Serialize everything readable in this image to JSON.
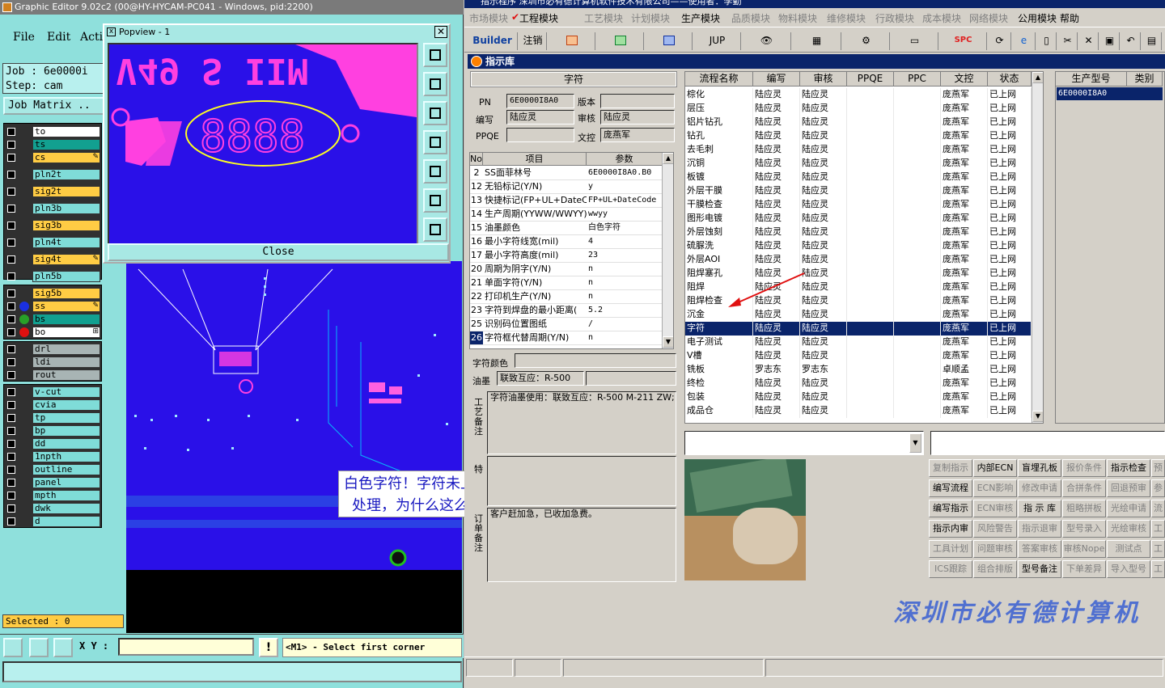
{
  "ge": {
    "title": "Graphic Editor 9.02c2 (00@HY-HYCAM-PC041 - Windows, pid:2200)",
    "menu": [
      "File",
      "Edit",
      "Acti"
    ],
    "job_line": "Job  :  6e0000i",
    "step_line": "Step:  cam",
    "job_matrix": "Job Matrix ..",
    "layers": [
      {
        "name": "to",
        "color": "#ffffff"
      },
      {
        "name": "ts",
        "color": "#12a090"
      },
      {
        "name": "cs",
        "color": "#ffcc44",
        "mark": "✎"
      },
      {
        "name": "pln2t",
        "color": "#7fdcd8"
      },
      {
        "name": "sig2t",
        "color": "#ffcc44"
      },
      {
        "name": "pln3b",
        "color": "#7fdcd8"
      },
      {
        "name": "sig3b",
        "color": "#ffcc44"
      },
      {
        "name": "pln4t",
        "color": "#7fdcd8"
      },
      {
        "name": "sig4t",
        "color": "#ffcc44",
        "mark": "✎"
      },
      {
        "name": "pln5b",
        "color": "#7fdcd8"
      },
      {
        "name": "sig5b",
        "color": "#ffcc44"
      },
      {
        "name": "ss",
        "color": "#ffcc44",
        "dot": "#1a30e0",
        "mark": "✎"
      },
      {
        "name": "bs",
        "color": "#12a090",
        "dot": "#28a028"
      },
      {
        "name": "bo",
        "color": "#ffffff",
        "dot": "#e01010",
        "mark": "⊞"
      },
      {
        "name": "drl",
        "color": "#a8b4b4"
      },
      {
        "name": "ldi",
        "color": "#a8b4b4"
      },
      {
        "name": "rout",
        "color": "#a8b4b4"
      },
      {
        "name": "v-cut",
        "color": "#7fdcd8"
      },
      {
        "name": "cvia",
        "color": "#7fdcd8"
      },
      {
        "name": "tp",
        "color": "#7fdcd8"
      },
      {
        "name": "bp",
        "color": "#7fdcd8"
      },
      {
        "name": "dd",
        "color": "#7fdcd8"
      },
      {
        "name": "1npth",
        "color": "#7fdcd8"
      },
      {
        "name": "outline",
        "color": "#7fdcd8"
      },
      {
        "name": "panel",
        "color": "#7fdcd8"
      },
      {
        "name": "mpth",
        "color": "#7fdcd8"
      },
      {
        "name": "dwk",
        "color": "#7fdcd8"
      },
      {
        "name": "d",
        "color": "#7fdcd8"
      }
    ],
    "selected": "Selected : 0",
    "xy_label": "X Y :",
    "xy_value": "",
    "bang": "!",
    "prompt": "<M1> - Select first corner",
    "popview": {
      "title": "Popview - 1",
      "close": "Close",
      "silk_top": "V49 S IIM",
      "digits": "8888"
    },
    "annotation": [
      "白色字符！字符未上表面",
      "处理，为什么这么做？"
    ]
  },
  "erp": {
    "title": "指示程序    深圳市必有德计算机软件技术有限公司——使用者：李勤",
    "menu": [
      {
        "label": "市场模块",
        "on": false
      },
      {
        "label": "工程模块",
        "on": true
      },
      {
        "label": "工艺模块",
        "on": false
      },
      {
        "label": "计划模块",
        "on": false
      },
      {
        "label": "生产模块",
        "on": true
      },
      {
        "label": "品质模块",
        "on": false
      },
      {
        "label": "物料模块",
        "on": false
      },
      {
        "label": "维修模块",
        "on": false
      },
      {
        "label": "行政模块",
        "on": false
      },
      {
        "label": "成本模块",
        "on": false
      },
      {
        "label": "网络模块",
        "on": false
      },
      {
        "label": "公用模块",
        "on": true
      },
      {
        "label": "帮助",
        "on": true
      }
    ],
    "toolbar": [
      "Builder",
      "注销",
      "JUP",
      "SPC"
    ],
    "panel_title": "指示库",
    "header_group": "字符",
    "pn_label": "PN",
    "pn_value": "6E0000I8A0",
    "ver_label": "版本",
    "ver_value": "",
    "bianxie_label": "编写",
    "bianxie_value": "陆应灵",
    "shenhe_label": "审核",
    "shenhe_value": "陆应灵",
    "ppqe_label": "PPQE",
    "ppqe_value": "",
    "wenkong_label": "文控",
    "wenkong_value": "庞燕军",
    "param_headers": [
      "No",
      "项目",
      "参数"
    ],
    "params": [
      {
        "no": "2",
        "item": "SS面菲林号",
        "val": "6E0000I8A0.B0"
      },
      {
        "no": "12",
        "item": "无铅标记(Y/N)",
        "val": "y"
      },
      {
        "no": "13",
        "item": "快捷标记(FP+UL+DateCo",
        "val": "FP+UL+DateCode"
      },
      {
        "no": "14",
        "item": "生产周期(YYWW/WWYY)",
        "val": "wwyy"
      },
      {
        "no": "15",
        "item": "油墨颜色",
        "val": "白色字符"
      },
      {
        "no": "16",
        "item": "最小字符线宽(mil)",
        "val": "4"
      },
      {
        "no": "17",
        "item": "最小字符高度(mil)",
        "val": "23"
      },
      {
        "no": "20",
        "item": "周期为阴字(Y/N)",
        "val": "n"
      },
      {
        "no": "21",
        "item": "单面字符(Y/N)",
        "val": "n"
      },
      {
        "no": "22",
        "item": "打印机生产(Y/N)",
        "val": "n"
      },
      {
        "no": "23",
        "item": "字符到焊盘的最小距离(",
        "val": "5.2"
      },
      {
        "no": "25",
        "item": "识别码位置图纸",
        "val": "/"
      },
      {
        "no": "26",
        "item": "字符框代替周期(Y/N)",
        "val": "n"
      }
    ],
    "char_color_label": "字符颜色",
    "char_color_value": "",
    "ink_label": "油墨",
    "ink_value": "联致互应：R-500",
    "ink_value2": "",
    "gyb_label": "工艺备注",
    "gyb_text": "字符油墨使用：联致互应：R-500 M-211 ZW;",
    "te_label": "特",
    "dd_label": "订单备注",
    "dd_text": "客户赶加急，已收加急费。",
    "flow_headers": [
      "流程名称",
      "编写",
      "审核",
      "PPQE",
      "PPC",
      "文控",
      "状态"
    ],
    "flow": [
      {
        "n": "棕化",
        "a": "陆应灵",
        "b": "陆应灵",
        "w": "庞燕军",
        "s": "已上网"
      },
      {
        "n": "层压",
        "a": "陆应灵",
        "b": "陆应灵",
        "w": "庞燕军",
        "s": "已上网"
      },
      {
        "n": "铝片钻孔",
        "a": "陆应灵",
        "b": "陆应灵",
        "w": "庞燕军",
        "s": "已上网"
      },
      {
        "n": "钻孔",
        "a": "陆应灵",
        "b": "陆应灵",
        "w": "庞燕军",
        "s": "已上网"
      },
      {
        "n": "去毛刺",
        "a": "陆应灵",
        "b": "陆应灵",
        "w": "庞燕军",
        "s": "已上网"
      },
      {
        "n": "沉铜",
        "a": "陆应灵",
        "b": "陆应灵",
        "w": "庞燕军",
        "s": "已上网"
      },
      {
        "n": "板镀",
        "a": "陆应灵",
        "b": "陆应灵",
        "w": "庞燕军",
        "s": "已上网"
      },
      {
        "n": "外层干膜",
        "a": "陆应灵",
        "b": "陆应灵",
        "w": "庞燕军",
        "s": "已上网"
      },
      {
        "n": "干膜检查",
        "a": "陆应灵",
        "b": "陆应灵",
        "w": "庞燕军",
        "s": "已上网"
      },
      {
        "n": "图形电镀",
        "a": "陆应灵",
        "b": "陆应灵",
        "w": "庞燕军",
        "s": "已上网"
      },
      {
        "n": "外层蚀刻",
        "a": "陆应灵",
        "b": "陆应灵",
        "w": "庞燕军",
        "s": "已上网"
      },
      {
        "n": "硫脲洗",
        "a": "陆应灵",
        "b": "陆应灵",
        "w": "庞燕军",
        "s": "已上网"
      },
      {
        "n": "外层AOI",
        "a": "陆应灵",
        "b": "陆应灵",
        "w": "庞燕军",
        "s": "已上网"
      },
      {
        "n": "阻焊塞孔",
        "a": "陆应灵",
        "b": "陆应灵",
        "w": "庞燕军",
        "s": "已上网"
      },
      {
        "n": "阻焊",
        "a": "陆应灵",
        "b": "陆应灵",
        "w": "庞燕军",
        "s": "已上网"
      },
      {
        "n": "阻焊检查",
        "a": "陆应灵",
        "b": "陆应灵",
        "w": "庞燕军",
        "s": "已上网"
      },
      {
        "n": "沉金",
        "a": "陆应灵",
        "b": "陆应灵",
        "w": "庞燕军",
        "s": "已上网"
      },
      {
        "n": "字符",
        "a": "陆应灵",
        "b": "陆应灵",
        "w": "庞燕军",
        "s": "已上网",
        "sel": true
      },
      {
        "n": "电子测试",
        "a": "陆应灵",
        "b": "陆应灵",
        "w": "庞燕军",
        "s": "已上网"
      },
      {
        "n": "V槽",
        "a": "陆应灵",
        "b": "陆应灵",
        "w": "庞燕军",
        "s": "已上网"
      },
      {
        "n": "铣板",
        "a": "罗志东",
        "b": "罗志东",
        "w": "卓顺孟",
        "s": "已上网"
      },
      {
        "n": "终检",
        "a": "陆应灵",
        "b": "陆应灵",
        "w": "庞燕军",
        "s": "已上网"
      },
      {
        "n": "包装",
        "a": "陆应灵",
        "b": "陆应灵",
        "w": "庞燕军",
        "s": "已上网"
      },
      {
        "n": "成品仓",
        "a": "陆应灵",
        "b": "陆应灵",
        "w": "庞燕军",
        "s": "已上网"
      }
    ],
    "model_headers": [
      "生产型号",
      "类别"
    ],
    "model_value": "6E0000I8A0",
    "buttons": [
      [
        {
          "t": "复制指示",
          "on": false
        },
        {
          "t": "内部ECN",
          "on": true
        },
        {
          "t": "盲埋孔板",
          "on": true
        },
        {
          "t": "报价条件",
          "on": false
        },
        {
          "t": "指示检查",
          "on": true
        },
        {
          "t": "预",
          "on": false
        }
      ],
      [
        {
          "t": "编写流程",
          "on": true
        },
        {
          "t": "ECN影响",
          "on": false
        },
        {
          "t": "修改申请",
          "on": false
        },
        {
          "t": "合拼条件",
          "on": false
        },
        {
          "t": "回退预审",
          "on": false
        },
        {
          "t": "参",
          "on": false
        }
      ],
      [
        {
          "t": "编写指示",
          "on": true
        },
        {
          "t": "ECN审核",
          "on": false
        },
        {
          "t": "指 示 库",
          "on": true
        },
        {
          "t": "粗略拼板",
          "on": false
        },
        {
          "t": "光绘申请",
          "on": false
        },
        {
          "t": "流",
          "on": false
        }
      ],
      [
        {
          "t": "指示内审",
          "on": true
        },
        {
          "t": "风险警告",
          "on": false
        },
        {
          "t": "指示退审",
          "on": false
        },
        {
          "t": "型号录入",
          "on": false
        },
        {
          "t": "光绘审核",
          "on": false
        },
        {
          "t": "工",
          "on": false
        }
      ],
      [
        {
          "t": "工具计划",
          "on": false
        },
        {
          "t": "问题审核",
          "on": false
        },
        {
          "t": "答案审核",
          "on": false
        },
        {
          "t": "审核Nope",
          "on": false
        },
        {
          "t": "测试点",
          "on": false
        },
        {
          "t": "工",
          "on": false
        }
      ],
      [
        {
          "t": "ICS跟踪",
          "on": false
        },
        {
          "t": "组合排版",
          "on": false
        },
        {
          "t": "型号备注",
          "on": true
        },
        {
          "t": "下单差异",
          "on": false
        },
        {
          "t": "导入型号",
          "on": false
        },
        {
          "t": "工",
          "on": false
        }
      ]
    ],
    "banner": "深圳市必有德计算机"
  }
}
